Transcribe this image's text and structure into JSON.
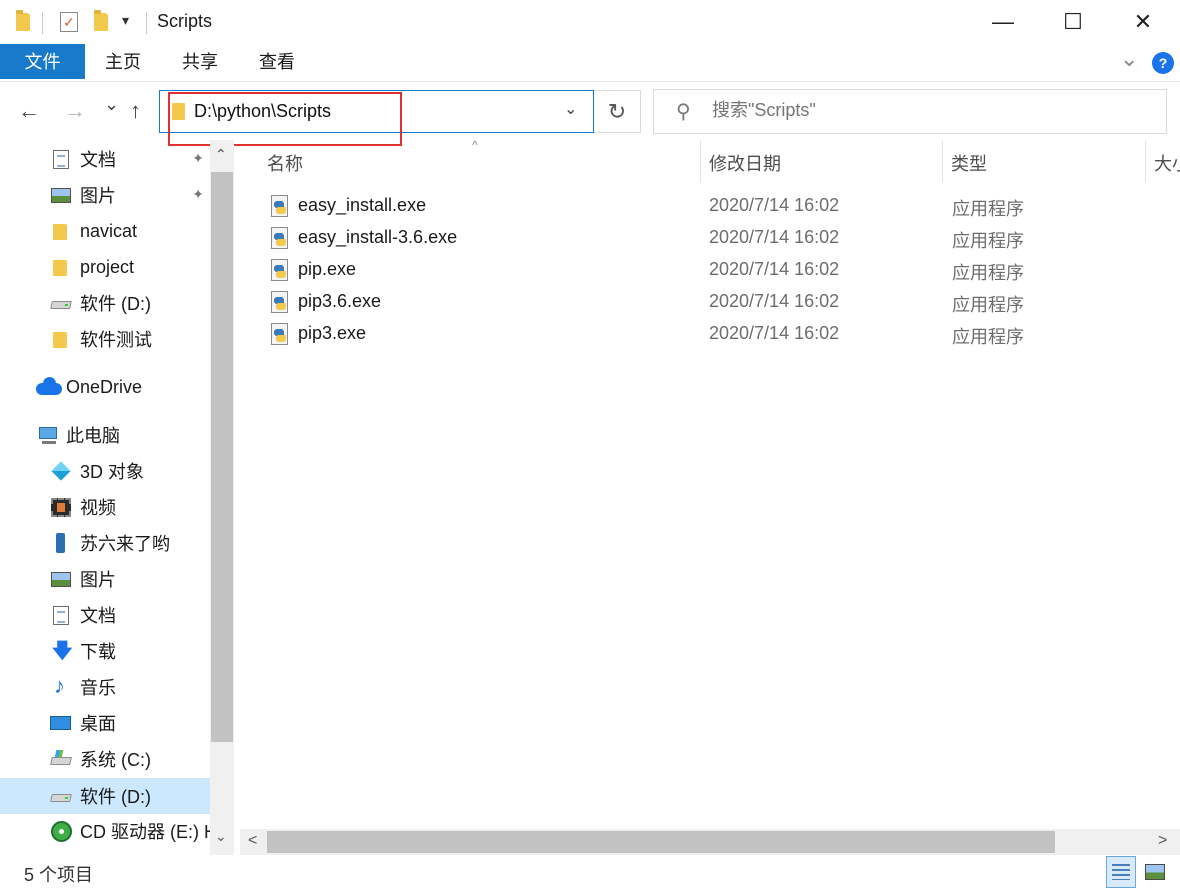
{
  "window": {
    "title": "Scripts",
    "controls": {
      "minimize": "—",
      "maximize": "☐",
      "close": "✕"
    },
    "qat_dropdown": "▾"
  },
  "ribbon": {
    "tabs": [
      {
        "label": "文件",
        "active": true
      },
      {
        "label": "主页"
      },
      {
        "label": "共享"
      },
      {
        "label": "查看"
      }
    ],
    "expand_glyph": "⌄",
    "help_glyph": "?"
  },
  "nav": {
    "back": "←",
    "forward": "→",
    "recent": "⌄",
    "up": "↑"
  },
  "address": {
    "path": "D:\\python\\Scripts",
    "dropdown": "⌄",
    "refresh": "↻"
  },
  "search": {
    "icon": "search-icon",
    "placeholder": "搜索\"Scripts\""
  },
  "sidebar": {
    "items": [
      {
        "label": "文档",
        "icon": "document-icon",
        "pinned": true
      },
      {
        "label": "图片",
        "icon": "picture-icon",
        "pinned": true
      },
      {
        "label": "navicat",
        "icon": "folder-icon"
      },
      {
        "label": "project",
        "icon": "folder-icon"
      },
      {
        "label": "软件 (D:)",
        "icon": "drive-icon"
      },
      {
        "label": "软件测试",
        "icon": "folder-icon"
      },
      {
        "label": "OneDrive",
        "icon": "onedrive-icon"
      },
      {
        "label": "此电脑",
        "icon": "computer-icon"
      },
      {
        "label": "3D 对象",
        "icon": "cube-icon"
      },
      {
        "label": "视频",
        "icon": "video-icon"
      },
      {
        "label": "苏六来了哟",
        "icon": "phone-icon"
      },
      {
        "label": "图片",
        "icon": "picture-icon"
      },
      {
        "label": "文档",
        "icon": "document-icon"
      },
      {
        "label": "下载",
        "icon": "download-icon"
      },
      {
        "label": "音乐",
        "icon": "music-icon"
      },
      {
        "label": "桌面",
        "icon": "desktop-icon"
      },
      {
        "label": "系统 (C:)",
        "icon": "system-drive-icon"
      },
      {
        "label": "软件 (D:)",
        "icon": "drive-icon",
        "selected": true
      },
      {
        "label": "CD 驱动器 (E:) H",
        "icon": "cd-drive-icon"
      }
    ],
    "pin_glyph": "📌",
    "scroll_up": "⌃",
    "scroll_down": "⌄"
  },
  "columns": {
    "name": "名称",
    "modified": "修改日期",
    "type": "类型",
    "size": "大小",
    "sort_glyph": "^"
  },
  "files": [
    {
      "name": "easy_install.exe",
      "modified": "2020/7/14 16:02",
      "type": "应用程序"
    },
    {
      "name": "easy_install-3.6.exe",
      "modified": "2020/7/14 16:02",
      "type": "应用程序"
    },
    {
      "name": "pip.exe",
      "modified": "2020/7/14 16:02",
      "type": "应用程序"
    },
    {
      "name": "pip3.6.exe",
      "modified": "2020/7/14 16:02",
      "type": "应用程序"
    },
    {
      "name": "pip3.exe",
      "modified": "2020/7/14 16:02",
      "type": "应用程序"
    }
  ],
  "hscroll": {
    "left": "<",
    "right": ">"
  },
  "status": {
    "item_count": "5 个项目",
    "view": "details"
  },
  "colors": {
    "accent": "#1979ca",
    "selection": "#cce8ff",
    "highlight_box": "#e03030"
  }
}
